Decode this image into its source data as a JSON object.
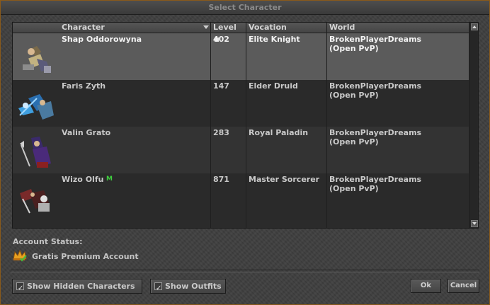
{
  "window": {
    "title": "Select Character"
  },
  "columns": {
    "character": "Character",
    "level": "Level",
    "vocation": "Vocation",
    "world": "World"
  },
  "characters": [
    {
      "name": "Shap Oddorowyna",
      "level": "402",
      "vocation": "Elite Knight",
      "world": "BrokenPlayerDreams",
      "world_type": "(Open PvP)",
      "selected": true,
      "badge": ""
    },
    {
      "name": "Faris Zyth",
      "level": "147",
      "vocation": "Elder Druid",
      "world": "BrokenPlayerDreams",
      "world_type": "(Open PvP)",
      "selected": false,
      "badge": ""
    },
    {
      "name": "Valin Grato",
      "level": "283",
      "vocation": "Royal Paladin",
      "world": "BrokenPlayerDreams",
      "world_type": "(Open PvP)",
      "selected": false,
      "badge": ""
    },
    {
      "name": "Wizo Olfu",
      "level": "871",
      "vocation": "Master Sorcerer",
      "world": "BrokenPlayerDreams",
      "world_type": "(Open PvP)",
      "selected": false,
      "badge": "M"
    }
  ],
  "account": {
    "label": "Account Status:",
    "value": "Gratis Premium Account"
  },
  "options": {
    "show_hidden": "Show Hidden Characters",
    "show_outfits": "Show Outfits",
    "show_hidden_checked": true,
    "show_outfits_checked": true
  },
  "buttons": {
    "ok": "Ok",
    "cancel": "Cancel"
  },
  "colors": {
    "frame": "#8a5a1a",
    "selected_row": "#5b5b5b",
    "badge": "#3fcf3f",
    "check": "#3fc23f"
  }
}
